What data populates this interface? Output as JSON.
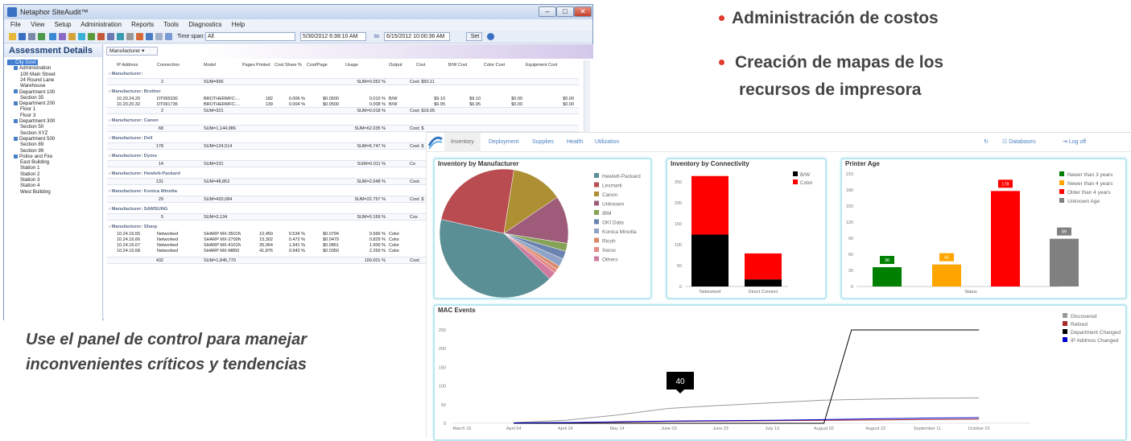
{
  "window": {
    "title": "Netaphor SiteAudit™"
  },
  "menu": [
    "File",
    "View",
    "Setup",
    "Administration",
    "Reports",
    "Tools",
    "Diagnostics",
    "Help"
  ],
  "toolbar": {
    "timespan_label": "Time span:",
    "timespan_value": "All",
    "from": "5/30/2012  6:38:10 AM",
    "to_label": "to",
    "to": "6/15/2012 10:00:36 AM",
    "set_button": "Set"
  },
  "sidebar": {
    "title": "Assessment Details",
    "items": [
      "City Govt",
      "Administration",
      "100 Main Street",
      "24 Round Lane",
      "Warehouse",
      "Department 100",
      "Section 35",
      "Department 200",
      "Floor 1",
      "Floor 3",
      "Department 300",
      "Section 50",
      "Section XYZ",
      "Department 500",
      "Section 89",
      "Section 99",
      "Police and Fire",
      "East Building",
      "Station 1",
      "Station 2",
      "Station 3",
      "Station 4",
      "West Building"
    ]
  },
  "grid": {
    "group_by": "Manufacturer",
    "columns": [
      "IP Address",
      "Connection",
      "Model",
      "Pages Printed",
      "Cost Share %",
      "Cost/Page",
      "Usage",
      "Output",
      "Cost",
      "B/W Cost",
      "Color Cost",
      "Equipment Cost"
    ],
    "groups": [
      {
        "name": "Manufacturer:",
        "count": "2",
        "sum": "SUM=956",
        "usage": "SUM=0.052 %",
        "cost": "Cost: $50.11",
        "rows": []
      },
      {
        "name": "Manufacturer: Brother",
        "count": "2",
        "sum": "SUM=321",
        "usage": "SUM=0.018 %",
        "cost": "Cost: $16.05",
        "rows": [
          [
            "10.20.24.20",
            "DT095330",
            "BROTHERMFC-...",
            "182",
            "0.006 %",
            "$0.0500",
            "0.010 %",
            "B/W",
            "$9.10",
            "$9.10",
            "$0.00",
            "$0.00"
          ],
          [
            "10.20.20.32",
            "DT091736",
            "BROTHERMFC-...",
            "139",
            "0.004 %",
            "$0.0500",
            "0.008 %",
            "B/W",
            "$6.95",
            "$6.95",
            "$0.00",
            "$0.00"
          ]
        ]
      },
      {
        "name": "Manufacturer: Canon",
        "count": "68",
        "sum": "SUM=1,144,986",
        "usage": "SUM=62.035 %",
        "cost": "Cost: $",
        "rows": []
      },
      {
        "name": "Manufacturer: Dell",
        "count": "178",
        "sum": "SUM=124,514",
        "usage": "SUM=6.747 %",
        "cost": "Cost: $",
        "rows": []
      },
      {
        "name": "Manufacturer: Dymo",
        "count": "14",
        "sum": "SUM=231",
        "usage": "SUM=0.011 %",
        "cost": "Co",
        "rows": []
      },
      {
        "name": "Manufacturer: Hewlett-Packard",
        "count": "131",
        "sum": "SUM=48,852",
        "usage": "SUM=2.648 %",
        "cost": "Cost:",
        "rows": []
      },
      {
        "name": "Manufacturer: Konica Minolta",
        "count": "29",
        "sum": "SUM=420,084",
        "usage": "SUM=22.757 %",
        "cost": "Cost: $",
        "rows": []
      },
      {
        "name": "Manufacturer: SAMSUNG",
        "count": "5",
        "sum": "SUM=3,134",
        "usage": "SUM=0.169 %",
        "cost": "Cos",
        "rows": []
      },
      {
        "name": "Manufacturer: Sharp",
        "count": "",
        "sum": "",
        "usage": "",
        "cost": "",
        "rows": [
          [
            "10.24.16.65",
            "Networked",
            "SHARP MX-3501N",
            "10,450",
            "0.534 %",
            "$0.0794",
            "0.566 %",
            "Color"
          ],
          [
            "10.24.16.66",
            "Networked",
            "SHARP MX-2700N",
            "15,302",
            "0.472 %",
            "$0.0479",
            "0.829 %",
            "Color"
          ],
          [
            "10.24.16.67",
            "Networked",
            "SHARP MX-4101N",
            "35,064",
            "1.941 %",
            "$0.0861",
            "1.900 %",
            "Color"
          ],
          [
            "10.24.16.68",
            "Networked",
            "SHARP MX-M850",
            "41,876",
            "0.943 %",
            "$0.0350",
            "2.269 %",
            "Color"
          ]
        ]
      }
    ],
    "total": {
      "count": "432",
      "sum": "SUM=1,845,770",
      "usage": "100.001 %",
      "cost": "Cost:"
    }
  },
  "bullets": [
    "Administración de costos",
    "Creación de mapas de los",
    "recursos de impresora"
  ],
  "caption": [
    "Use el panel de control para manejar",
    "inconvenientes críticos y tendencias"
  ],
  "dashboard": {
    "tabs": [
      "Inventory",
      "Deployment",
      "Supplies",
      "Health",
      "Utilization"
    ],
    "databases": "Databases",
    "logoff": "Log off",
    "refresh_icon": "refresh-icon"
  },
  "chart_data": [
    {
      "type": "pie",
      "title": "Inventory by Manufacturer",
      "categories": [
        "Hewlett-Packard",
        "Lexmark",
        "Canon",
        "Unknown",
        "IBM",
        "OKI Data",
        "Konica Minolta",
        "Ricoh",
        "Xerox",
        "Others"
      ],
      "values": [
        41,
        24,
        13,
        12,
        2,
        2,
        2,
        1,
        1,
        2
      ],
      "colors": [
        "#5b8f96",
        "#b84c50",
        "#ad9033",
        "#9e5b7a",
        "#86a257",
        "#6b83b0",
        "#8ea3c7",
        "#d98a6a",
        "#e68a86",
        "#d07aa0"
      ]
    },
    {
      "type": "bar",
      "title": "Inventory by Connectivity",
      "stacked": true,
      "categories": [
        "Networked",
        "Direct Connect"
      ],
      "series": [
        {
          "name": "B/W",
          "values": [
            124,
            17
          ],
          "color": "#000000"
        },
        {
          "name": "Color",
          "values": [
            140,
            62
          ],
          "color": "#ff0000"
        }
      ],
      "ylim": [
        0,
        250
      ],
      "yticks": [
        0,
        50,
        100,
        150,
        200,
        250
      ]
    },
    {
      "type": "bar",
      "title": "Printer Age",
      "categories": [
        "Status"
      ],
      "xlabel": "Status",
      "series": [
        {
          "name": "Newer than 3 years",
          "values": [
            36
          ],
          "color": "#008000"
        },
        {
          "name": "Newer than 4 years",
          "values": [
            41
          ],
          "color": "#ffa500"
        },
        {
          "name": "Older than 4 years",
          "values": [
            178
          ],
          "color": "#ff0000"
        },
        {
          "name": "Unknown Age",
          "values": [
            89
          ],
          "color": "#808080"
        }
      ],
      "ylim": [
        0,
        210
      ],
      "yticks": [
        0,
        30,
        60,
        90,
        120,
        150,
        180,
        210
      ]
    },
    {
      "type": "line",
      "title": "MAC Events",
      "x": [
        "March 15",
        "April 04",
        "April 24",
        "May 14",
        "June 03",
        "June 23",
        "July 13",
        "August 02",
        "August 22",
        "September 11",
        "October 01"
      ],
      "series": [
        {
          "name": "Discovered",
          "color": "#999999",
          "values": [
            0,
            2,
            8,
            22,
            40,
            48,
            55,
            62,
            65,
            67,
            68
          ]
        },
        {
          "name": "Retired",
          "color": "#a52a2a",
          "values": [
            0,
            1,
            2,
            3,
            5,
            6,
            7,
            8,
            9,
            10,
            11
          ]
        },
        {
          "name": "Department Changed",
          "color": "#000000",
          "values": [
            0,
            0,
            0,
            0,
            0,
            0,
            0,
            0,
            260,
            260,
            260
          ]
        },
        {
          "name": "IP Address Changed",
          "color": "#0000cc",
          "values": [
            0,
            1,
            2,
            4,
            6,
            7,
            8,
            10,
            12,
            14,
            15
          ]
        }
      ],
      "ylim": [
        0,
        250
      ],
      "yticks": [
        0,
        50,
        100,
        150,
        200,
        250
      ],
      "tooltip": "40"
    }
  ]
}
